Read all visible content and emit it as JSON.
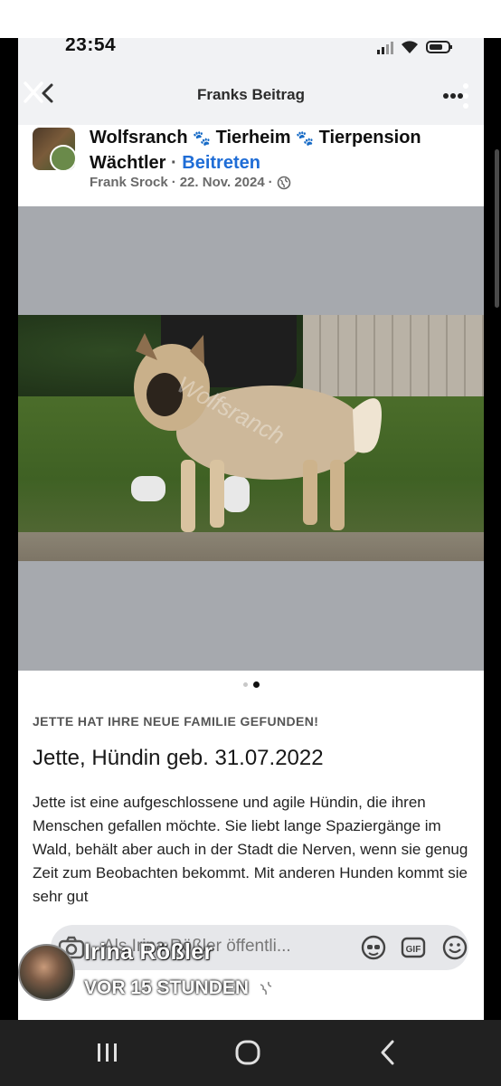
{
  "status_bar": {
    "time": "23:54"
  },
  "nav": {
    "title": "Franks Beitrag"
  },
  "post": {
    "group_name_part1": "Wolfsranch",
    "paw_glyph": "🐾",
    "group_name_part2": "Tierheim",
    "group_name_part3": "Tierpension",
    "group_name_part4": "Wächtler",
    "separator": "·",
    "join_label": "Beitreten",
    "author": "Frank Srock",
    "date": "22. Nov. 2024",
    "visibility_icon": "globe-icon"
  },
  "carousel": {
    "total": 2,
    "active_index": 1
  },
  "content": {
    "banner": "JETTE HAT IHRE NEUE FAMILIE GEFUNDEN!",
    "title": "Jette, Hündin geb. 31.07.2022",
    "body": "Jette ist eine aufgeschlossene und agile Hündin, die ihren Menschen gefallen möchte. Sie liebt lange Spaziergänge im Wald, behält aber auch in der Stadt die Nerven, wenn sie genug Zeit zum Beobachten bekommt. Mit anderen Hunden kommt sie sehr gut"
  },
  "comment_bar": {
    "placeholder": "Als Irina Rößler öffentli...",
    "icons": [
      "camera-icon",
      "avatar-sticker-icon",
      "gif-icon",
      "emoji-icon"
    ]
  },
  "overlay": {
    "name": "Irina Rößler",
    "time": "VOR 15 STUNDEN"
  },
  "android_nav": {
    "icons": [
      "recent-apps-icon",
      "home-icon",
      "back-icon"
    ]
  }
}
